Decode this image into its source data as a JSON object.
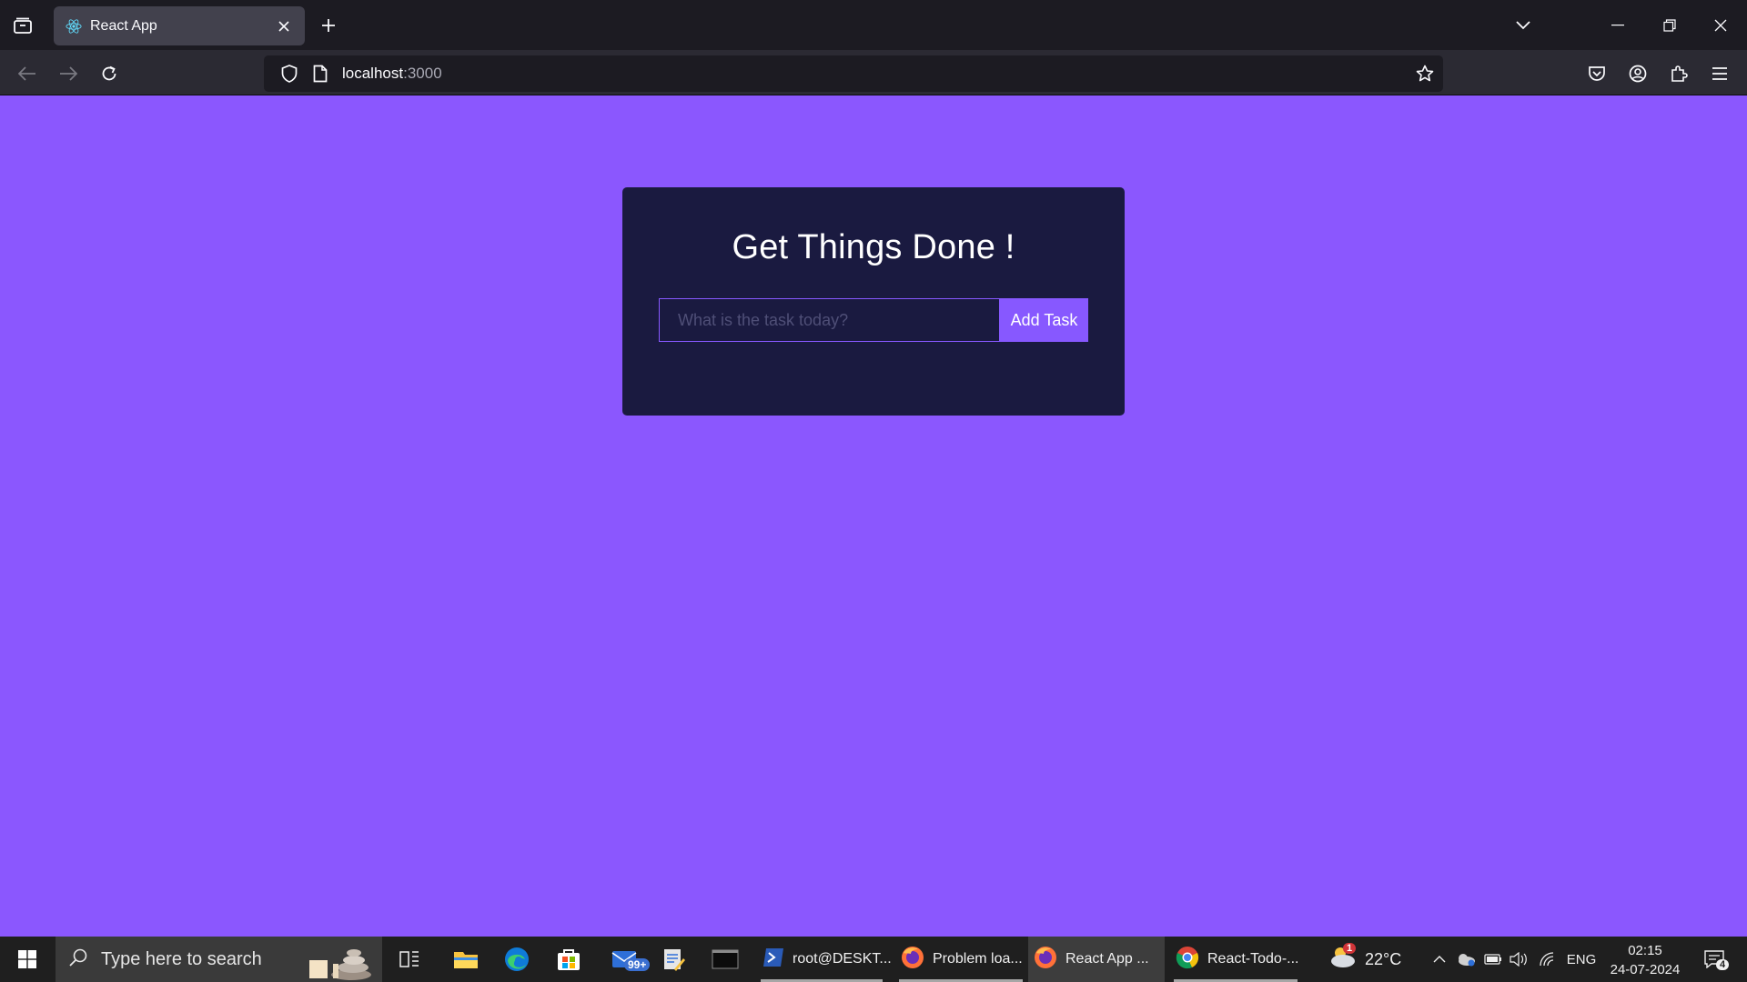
{
  "browser": {
    "tab_title": "React App",
    "url_host": "localhost",
    "url_port": ":3000"
  },
  "page": {
    "title": "Get Things Done !",
    "input_placeholder": "What is the task today?",
    "input_value": "",
    "add_button_label": "Add Task"
  },
  "taskbar": {
    "search_placeholder": "Type here to search",
    "mail_badge": "99+",
    "apps": [
      {
        "label": "root@DESKT...",
        "icon": "powershell-icon"
      },
      {
        "label": "Problem loa...",
        "icon": "firefox-icon"
      },
      {
        "label": "React App ...",
        "icon": "firefox-icon"
      },
      {
        "label": "React-Todo-...",
        "icon": "chrome-icon"
      }
    ],
    "weather_temp": "22°C",
    "weather_badge": "1",
    "language": "ENG",
    "time": "02:15",
    "date": "24-07-2024",
    "notification_count": "4"
  },
  "colors": {
    "page_background": "#8b57fe",
    "card_background": "#1a1a40",
    "accent": "#8758ff"
  }
}
